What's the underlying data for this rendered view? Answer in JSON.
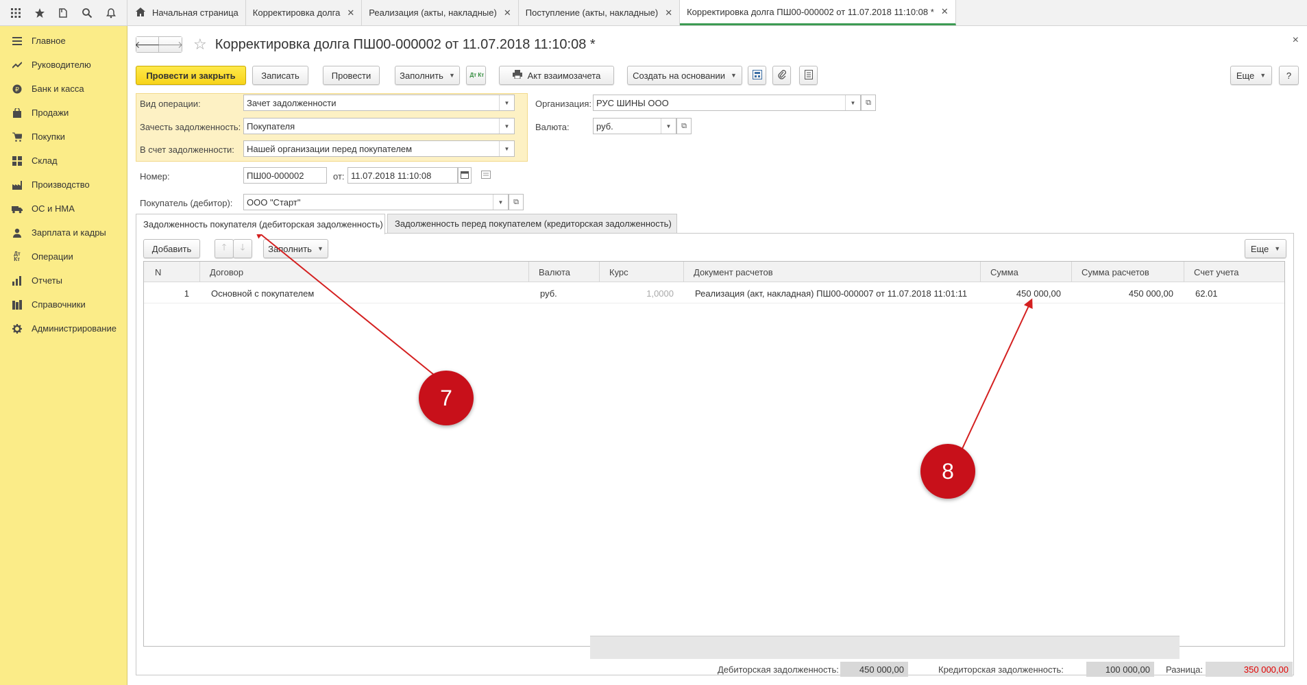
{
  "top_icons": [
    "apps-grid-icon",
    "star-icon",
    "history-icon",
    "search-icon",
    "bell-icon"
  ],
  "sidebar": {
    "items": [
      {
        "label": "Главное",
        "icon": "menu-lines-icon"
      },
      {
        "label": "Руководителю",
        "icon": "trend-icon"
      },
      {
        "label": "Банк и касса",
        "icon": "coin-icon"
      },
      {
        "label": "Продажи",
        "icon": "bag-icon"
      },
      {
        "label": "Покупки",
        "icon": "cart-icon"
      },
      {
        "label": "Склад",
        "icon": "warehouse-icon"
      },
      {
        "label": "Производство",
        "icon": "factory-icon"
      },
      {
        "label": "ОС и НМА",
        "icon": "truck-icon"
      },
      {
        "label": "Зарплата и кадры",
        "icon": "person-icon"
      },
      {
        "label": "Операции",
        "icon": "dt-kt-icon"
      },
      {
        "label": "Отчеты",
        "icon": "chart-icon"
      },
      {
        "label": "Справочники",
        "icon": "books-icon"
      },
      {
        "label": "Администрирование",
        "icon": "gear-icon"
      }
    ]
  },
  "tabs": [
    {
      "label": "Начальная страница",
      "closable": false,
      "active": false
    },
    {
      "label": "Корректировка долга",
      "closable": true,
      "active": false
    },
    {
      "label": "Реализация (акты, накладные)",
      "closable": true,
      "active": false
    },
    {
      "label": "Поступление (акты, накладные)",
      "closable": true,
      "active": false
    },
    {
      "label": "Корректировка долга ПШ00-000002 от 11.07.2018 11:10:08 *",
      "closable": true,
      "active": true
    }
  ],
  "form": {
    "title": "Корректировка долга ПШ00-000002 от 11.07.2018 11:10:08 *",
    "close_glyph": "×"
  },
  "toolbar": {
    "post_close": "Провести и закрыть",
    "save": "Записать",
    "post": "Провести",
    "fill": "Заполнить",
    "dtkt": "Дт Кт",
    "offset_act": "Акт взаимозачета",
    "create_based": "Создать на основании",
    "more": "Еще",
    "help": "?"
  },
  "fields": {
    "operation_label": "Вид операции:",
    "operation_value": "Зачет задолженности",
    "offset_debt_label": "Зачесть задолженность:",
    "offset_debt_value": "Покупателя",
    "against_label": "В счет задолженности:",
    "against_value": "Нашей организации перед покупателем",
    "org_label": "Организация:",
    "org_value": "РУС ШИНЫ ООО",
    "currency_label": "Валюта:",
    "currency_value": "руб.",
    "number_label": "Номер:",
    "number_value": "ПШ00-000002",
    "date_label": "от:",
    "date_value": "11.07.2018 11:10:08",
    "buyer_label": "Покупатель (дебитор):",
    "buyer_value": "ООО \"Старт\""
  },
  "inner_tabs": [
    {
      "label": "Задолженность покупателя (дебиторская задолженность)",
      "active": true
    },
    {
      "label": "Задолженность перед покупателем (кредиторская задолженность)",
      "active": false
    }
  ],
  "table_toolbar": {
    "add": "Добавить",
    "fill": "Заполнить",
    "more": "Еще"
  },
  "table": {
    "columns": [
      "N",
      "Договор",
      "Валюта",
      "Курс",
      "Документ расчетов",
      "Сумма",
      "Сумма расчетов",
      "Счет учета"
    ],
    "rows": [
      [
        "1",
        "Основной с покупателем",
        "руб.",
        "1,0000",
        "Реализация (акт, накладная) ПШ00-000007 от 11.07.2018 11:01:11",
        "450 000,00",
        "450 000,00",
        "62.01"
      ]
    ]
  },
  "totals": {
    "debit_label": "Дебиторская задолженность:",
    "debit_value": "450 000,00",
    "credit_label": "Кредиторская задолженность:",
    "credit_value": "100 000,00",
    "diff_label": "Разница:",
    "diff_value": "350 000,00"
  },
  "annotations": {
    "badge_1": "7",
    "badge_2": "8"
  },
  "colors": {
    "sidebar_bg": "#fbec88",
    "primary_button": "#f7d31a",
    "active_tab_underline": "#3d9b53",
    "annotation_red": "#c8101a",
    "difference_value": "#e00000"
  }
}
